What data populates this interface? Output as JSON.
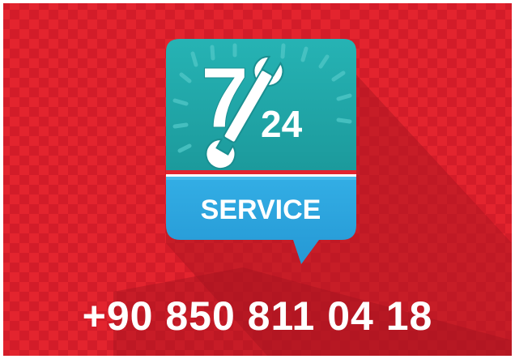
{
  "badge": {
    "number_main": "7",
    "number_sub": "24",
    "service_label": "SERVICE",
    "wrench_icon": "wrench-icon"
  },
  "contact": {
    "phone": "+90 850 811 04 18"
  },
  "colors": {
    "background_red": "#e3242e",
    "checker_dark": "#cf1b28",
    "badge_teal": "#21a6a8",
    "speech_blue": "#29a3dd",
    "text_white": "#ffffff"
  }
}
